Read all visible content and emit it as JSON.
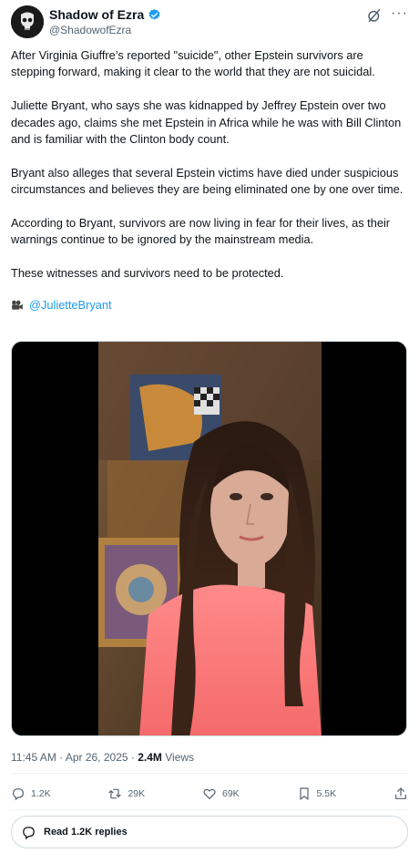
{
  "author": {
    "display_name": "Shadow of Ezra",
    "handle": "@ShadowofEzra",
    "verified_color": "#1d9bf0"
  },
  "tweet": {
    "paragraphs": [
      "After Virginia Giuffre’s reported \"suicide\", other Epstein survivors are stepping forward, making it clear to the world that they are not suicidal.",
      "Juliette Bryant, who says she was kidnapped by Jeffrey Epstein over two decades ago, claims she met Epstein in Africa while he was with Bill Clinton and is familiar with the Clinton body count.",
      "Bryant also alleges that several Epstein victims have died under suspicious circumstances and believes they are being eliminated one by one over time.",
      "According to Bryant, survivors are now living in fear for their lives, as their warnings continue to be ignored by the mainstream media.",
      "These witnesses and survivors need to be protected."
    ],
    "mention": "@JulietteBryant",
    "mention_icon": "video-camera-icon"
  },
  "meta": {
    "time": "11:45 AM",
    "date": "Apr 26, 2025",
    "views_count": "2.4M",
    "views_label": "Views"
  },
  "actions": {
    "replies": "1.2K",
    "reposts": "29K",
    "likes": "69K",
    "bookmarks": "5.5K"
  },
  "read_replies_label": "Read 1.2K replies",
  "colors": {
    "accent": "#1d9bf0",
    "muted": "#536471",
    "text": "#0f1419"
  }
}
